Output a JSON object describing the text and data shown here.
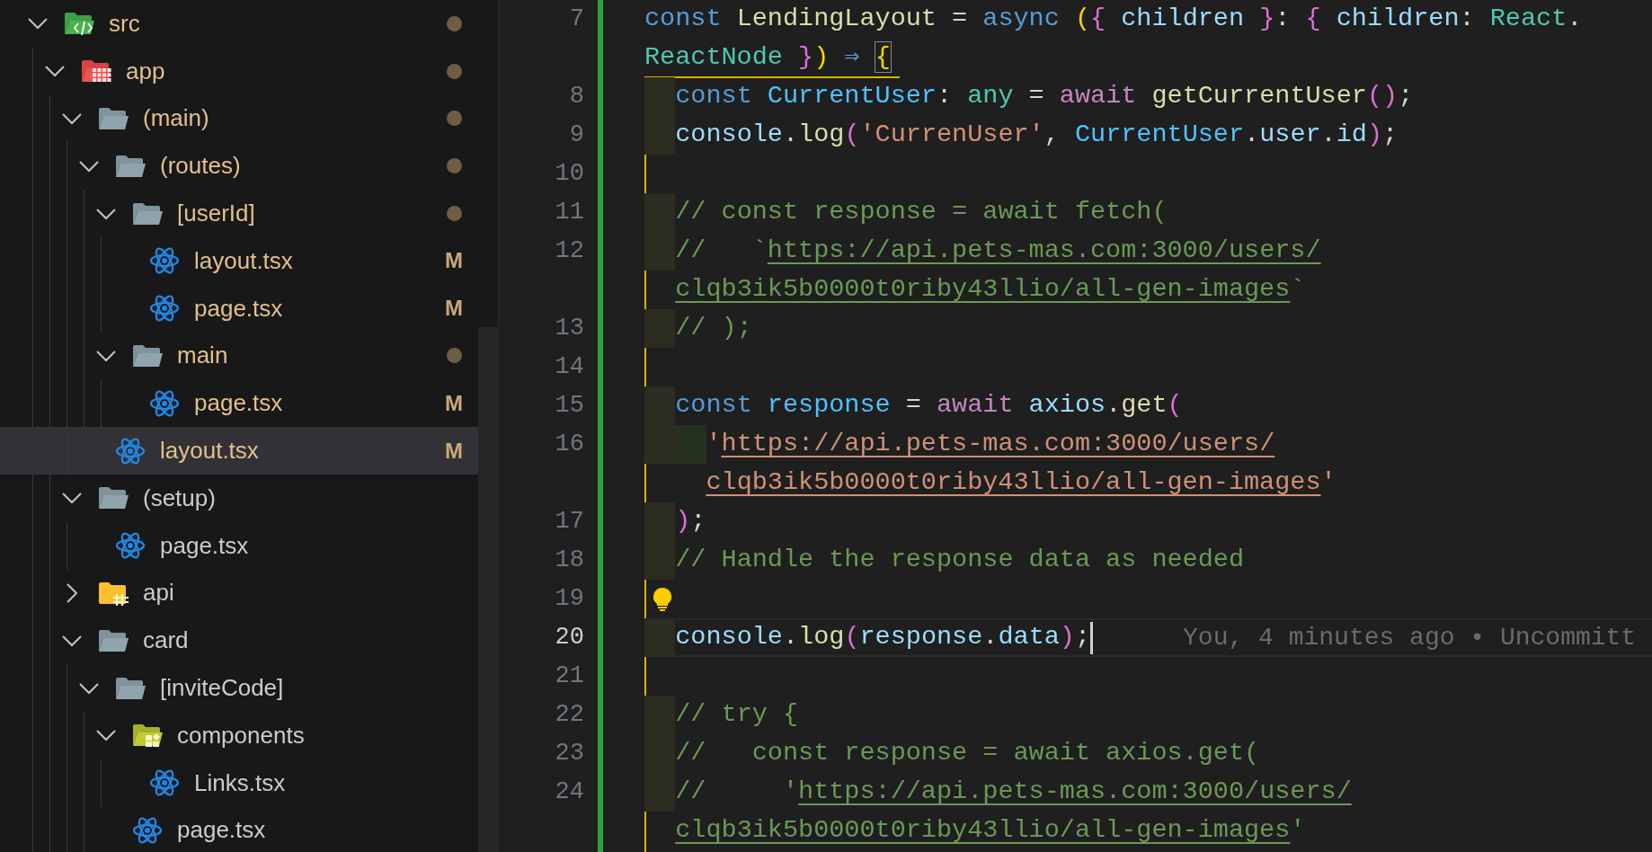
{
  "explorer": {
    "tree": [
      {
        "name": "src",
        "kind": "code-folder",
        "expanded": true,
        "modified": true,
        "selected": false,
        "children": [
          {
            "name": "app",
            "kind": "grid-folder",
            "expanded": true,
            "modified": true,
            "selected": false,
            "children": [
              {
                "name": "(main)",
                "kind": "folder",
                "expanded": true,
                "modified": true,
                "selected": false,
                "children": [
                  {
                    "name": "(routes)",
                    "kind": "folder",
                    "expanded": true,
                    "modified": true,
                    "selected": false,
                    "children": [
                      {
                        "name": "[userId]",
                        "kind": "folder",
                        "expanded": true,
                        "modified": true,
                        "selected": false,
                        "children": [
                          {
                            "name": "layout.tsx",
                            "kind": "file",
                            "modified": true,
                            "badge": "M",
                            "selected": false
                          },
                          {
                            "name": "page.tsx",
                            "kind": "file",
                            "modified": true,
                            "badge": "M",
                            "selected": false
                          }
                        ]
                      },
                      {
                        "name": "main",
                        "kind": "folder",
                        "expanded": true,
                        "modified": true,
                        "selected": false,
                        "children": [
                          {
                            "name": "page.tsx",
                            "kind": "file",
                            "modified": true,
                            "badge": "M",
                            "selected": false
                          }
                        ]
                      }
                    ]
                  },
                  {
                    "name": "layout.tsx",
                    "kind": "file",
                    "modified": true,
                    "badge": "M",
                    "selected": true
                  }
                ]
              },
              {
                "name": "(setup)",
                "kind": "folder",
                "expanded": true,
                "modified": false,
                "selected": false,
                "children": [
                  {
                    "name": "page.tsx",
                    "kind": "file",
                    "modified": false,
                    "selected": false
                  }
                ]
              },
              {
                "name": "api",
                "kind": "hash-folder",
                "expanded": false,
                "modified": false,
                "selected": false
              },
              {
                "name": "card",
                "kind": "folder",
                "expanded": true,
                "modified": false,
                "selected": false,
                "children": [
                  {
                    "name": "[inviteCode]",
                    "kind": "folder",
                    "expanded": true,
                    "modified": false,
                    "selected": false,
                    "children": [
                      {
                        "name": "components",
                        "kind": "blocks-folder",
                        "expanded": true,
                        "modified": false,
                        "selected": false,
                        "children": [
                          {
                            "name": "Links.tsx",
                            "kind": "file",
                            "modified": false,
                            "selected": false
                          }
                        ]
                      },
                      {
                        "name": "page.tsx",
                        "kind": "file",
                        "modified": false,
                        "selected": false
                      }
                    ]
                  }
                ]
              }
            ]
          }
        ]
      }
    ]
  },
  "editor": {
    "rows": [
      {
        "number": "7",
        "current": false,
        "tokens": [
          {
            "kind": "kw",
            "text": "const "
          },
          {
            "kind": "fn",
            "text": "LendingLayout"
          },
          {
            "kind": "p",
            "text": " = "
          },
          {
            "kind": "kw",
            "text": "async "
          },
          {
            "kind": "b1",
            "text": "("
          },
          {
            "kind": "b2",
            "text": "{"
          },
          {
            "kind": "var",
            "text": " children "
          },
          {
            "kind": "b2",
            "text": "}"
          },
          {
            "kind": "p",
            "text": ": "
          },
          {
            "kind": "b2",
            "text": "{"
          },
          {
            "kind": "var",
            "text": " children"
          },
          {
            "kind": "p",
            "text": ": "
          },
          {
            "kind": "type",
            "text": "React"
          },
          {
            "kind": "p",
            "text": "."
          }
        ]
      },
      {
        "current": false,
        "tokens": [
          {
            "kind": "type",
            "text": "ReactNode "
          },
          {
            "kind": "b2",
            "text": "}"
          },
          {
            "kind": "b1",
            "text": ")"
          },
          {
            "kind": "kw",
            "text": " ⇒ "
          },
          {
            "kind": "b1m",
            "text": "{"
          }
        ]
      },
      {
        "number": "8",
        "current": false,
        "tokens": [
          {
            "kind": "kw",
            "text": "  const "
          },
          {
            "kind": "const",
            "text": "CurrentUser"
          },
          {
            "kind": "p",
            "text": ": "
          },
          {
            "kind": "type",
            "text": "any"
          },
          {
            "kind": "p",
            "text": " = "
          },
          {
            "kind": "ctrl",
            "text": "await "
          },
          {
            "kind": "fn",
            "text": "getCurrentUser"
          },
          {
            "kind": "b2",
            "text": "()"
          },
          {
            "kind": "p",
            "text": ";"
          }
        ]
      },
      {
        "number": "9",
        "current": false,
        "tokens": [
          {
            "kind": "var",
            "text": "  console"
          },
          {
            "kind": "p",
            "text": "."
          },
          {
            "kind": "fn",
            "text": "log"
          },
          {
            "kind": "b2",
            "text": "("
          },
          {
            "kind": "str",
            "text": "'CurrenUser'"
          },
          {
            "kind": "p",
            "text": ", "
          },
          {
            "kind": "const",
            "text": "CurrentUser"
          },
          {
            "kind": "p",
            "text": "."
          },
          {
            "kind": "var",
            "text": "user"
          },
          {
            "kind": "p",
            "text": "."
          },
          {
            "kind": "var",
            "text": "id"
          },
          {
            "kind": "b2",
            "text": ")"
          },
          {
            "kind": "p",
            "text": ";"
          }
        ]
      },
      {
        "number": "10",
        "current": false
      },
      {
        "number": "11",
        "current": false,
        "tokens": [
          {
            "kind": "cmt",
            "text": "  // const response = await fetch("
          }
        ]
      },
      {
        "number": "12",
        "current": false,
        "tokens": [
          {
            "kind": "cmt",
            "text": "  //   `"
          },
          {
            "kind": "clink",
            "text": "https://api.pets-mas.com:3000/users/"
          }
        ]
      },
      {
        "current": false,
        "tokens": [
          {
            "kind": "clink",
            "text": "  clqb3ik5b0000t0riby43llio/all-gen-images"
          },
          {
            "kind": "cmt",
            "text": "`"
          }
        ]
      },
      {
        "number": "13",
        "current": false,
        "tokens": [
          {
            "kind": "cmt",
            "text": "  // );"
          }
        ]
      },
      {
        "number": "14",
        "current": false
      },
      {
        "number": "15",
        "current": false,
        "tokens": [
          {
            "kind": "kw",
            "text": "  const "
          },
          {
            "kind": "const",
            "text": "response"
          },
          {
            "kind": "p",
            "text": " = "
          },
          {
            "kind": "ctrl",
            "text": "await "
          },
          {
            "kind": "var",
            "text": "axios"
          },
          {
            "kind": "p",
            "text": "."
          },
          {
            "kind": "fn",
            "text": "get"
          },
          {
            "kind": "b2",
            "text": "("
          }
        ]
      },
      {
        "number": "16",
        "current": false,
        "tokens": [
          {
            "kind": "str",
            "text": "    '"
          },
          {
            "kind": "slink",
            "text": "https://api.pets-mas.com:3000/users/"
          }
        ]
      },
      {
        "current": false,
        "tokens": [
          {
            "kind": "slink",
            "text": "    clqb3ik5b0000t0riby43llio/all-gen-images"
          },
          {
            "kind": "str",
            "text": "'"
          }
        ]
      },
      {
        "number": "17",
        "current": false,
        "tokens": [
          {
            "kind": "b2",
            "text": "  )"
          },
          {
            "kind": "p",
            "text": ";"
          }
        ]
      },
      {
        "number": "18",
        "current": false,
        "tokens": [
          {
            "kind": "cmt",
            "text": "  // Handle the response data as needed"
          }
        ]
      },
      {
        "number": "19",
        "current": false,
        "lightbulb": true
      },
      {
        "number": "20",
        "current": true,
        "blame": "You, 4 minutes ago • Uncommitt",
        "tokens": [
          {
            "kind": "var",
            "text": "  console"
          },
          {
            "kind": "p",
            "text": "."
          },
          {
            "kind": "fn",
            "text": "log"
          },
          {
            "kind": "b2",
            "text": "("
          },
          {
            "kind": "var",
            "text": "response"
          },
          {
            "kind": "p",
            "text": "."
          },
          {
            "kind": "var",
            "text": "data"
          },
          {
            "kind": "b2",
            "text": ")"
          },
          {
            "kind": "p",
            "text": ";"
          }
        ]
      },
      {
        "number": "21",
        "current": false
      },
      {
        "number": "22",
        "current": false,
        "tokens": [
          {
            "kind": "cmt",
            "text": "  // try {"
          }
        ]
      },
      {
        "number": "23",
        "current": false,
        "tokens": [
          {
            "kind": "cmt",
            "text": "  //   const response = await axios.get("
          }
        ]
      },
      {
        "number": "24",
        "current": false,
        "tokens": [
          {
            "kind": "cmt",
            "text": "  //     '"
          },
          {
            "kind": "clink",
            "text": "https://api.pets-mas.com:3000/users/"
          }
        ]
      },
      {
        "current": false,
        "tokens": [
          {
            "kind": "clink",
            "text": "  clqb3ik5b0000t0riby43llio/all-gen-images"
          },
          {
            "kind": "cmt",
            "text": "'"
          }
        ]
      }
    ]
  }
}
